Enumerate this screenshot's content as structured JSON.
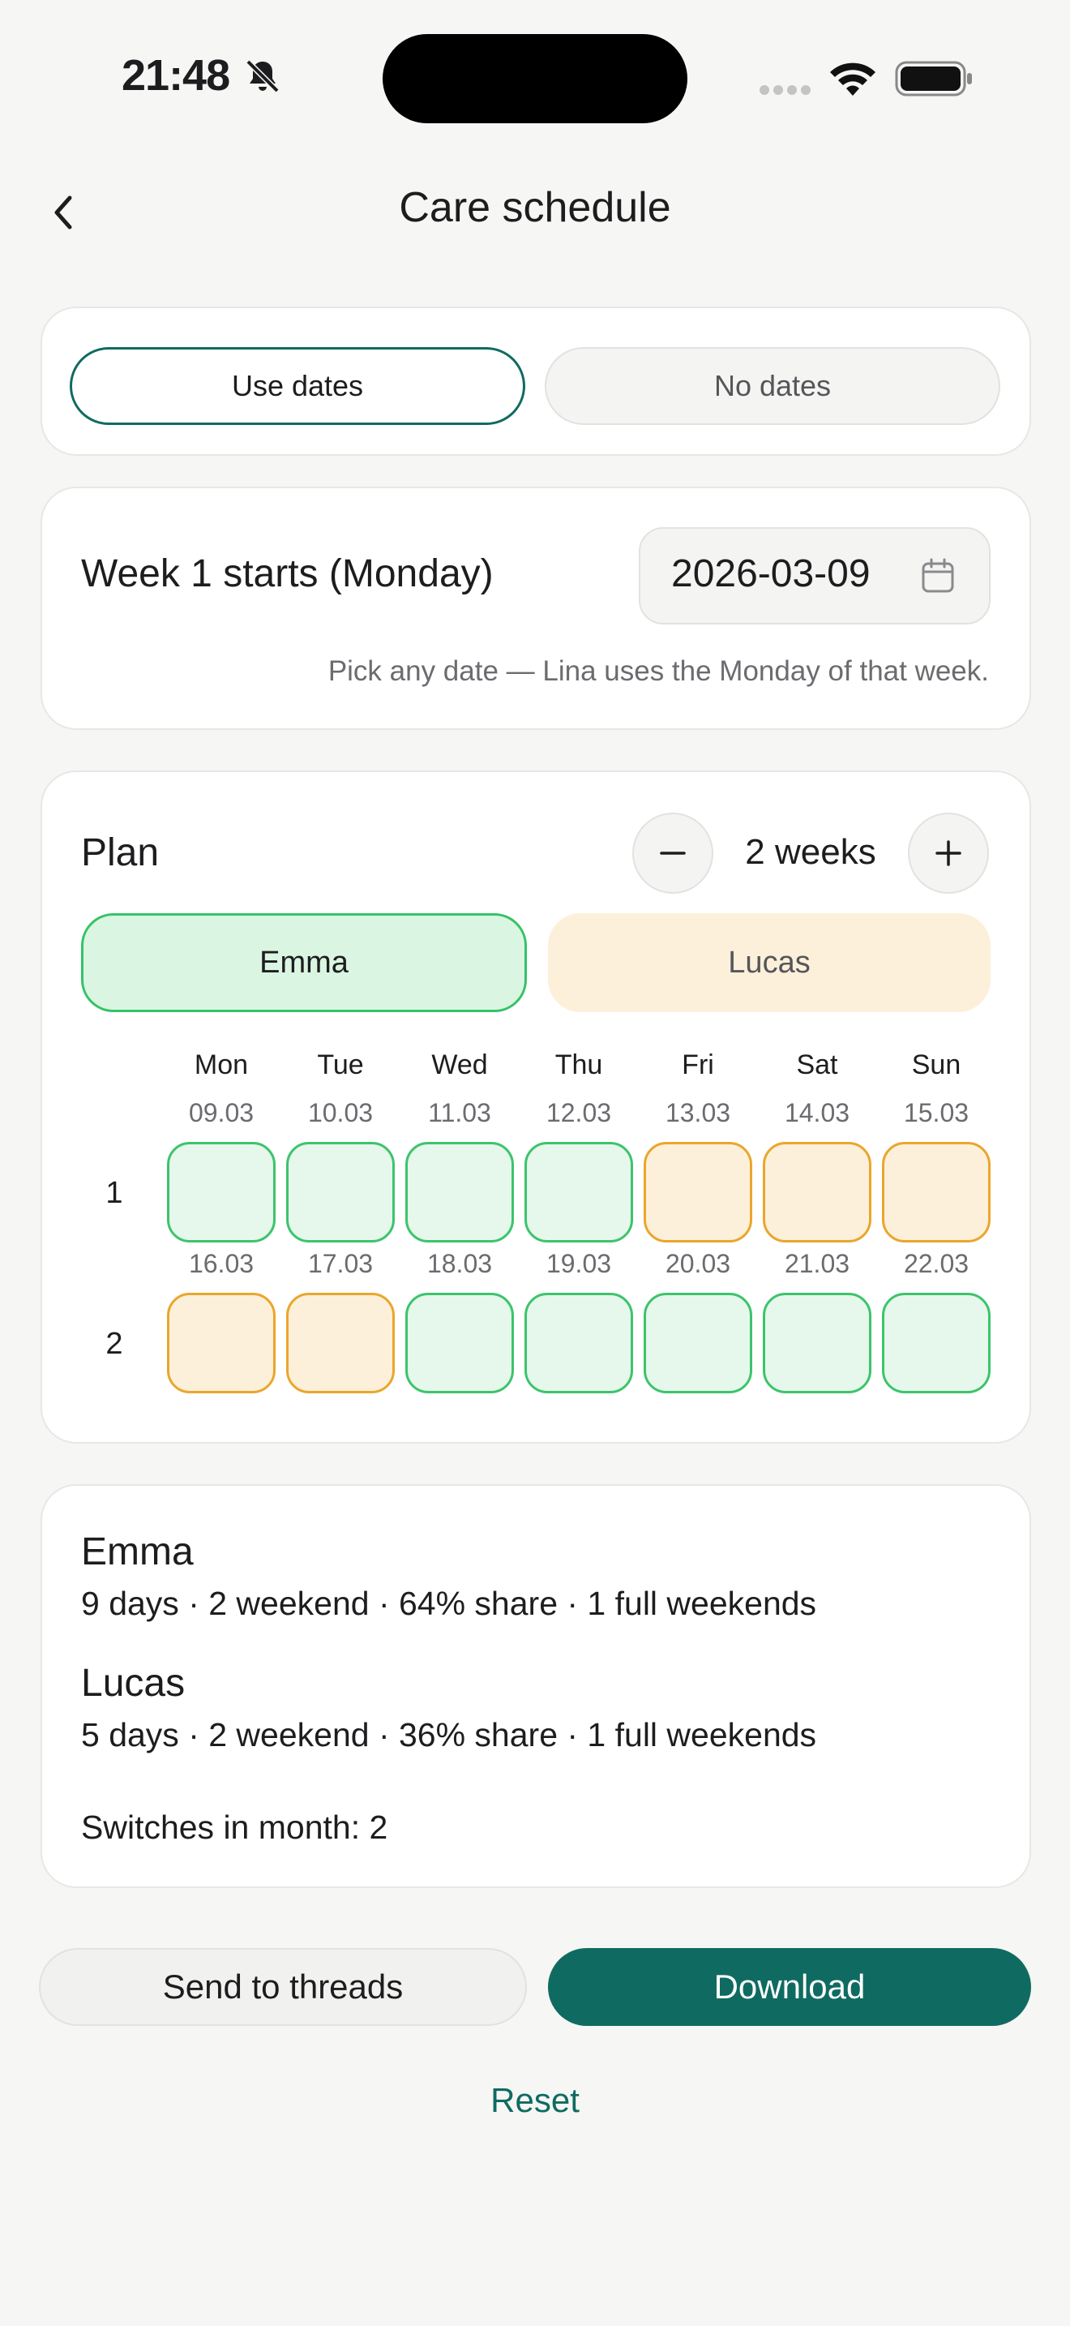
{
  "status_bar": {
    "time": "21:48"
  },
  "header": {
    "title": "Care schedule"
  },
  "mode": {
    "options": [
      "Use dates",
      "No dates"
    ],
    "selected": "Use dates"
  },
  "week_start": {
    "label": "Week 1 starts (Monday)",
    "date": "2026-03-09",
    "hint": "Pick any date — Lina uses the Monday of that week."
  },
  "plan": {
    "label": "Plan",
    "weeks_value": "2 weeks",
    "people": [
      "Emma",
      "Lucas"
    ],
    "selected_person": "Emma",
    "day_names": [
      "Mon",
      "Tue",
      "Wed",
      "Thu",
      "Fri",
      "Sat",
      "Sun"
    ],
    "weeks": [
      {
        "number": "1",
        "dates": [
          "09.03",
          "10.03",
          "11.03",
          "12.03",
          "13.03",
          "14.03",
          "15.03"
        ],
        "assign": [
          "Emma",
          "Emma",
          "Emma",
          "Emma",
          "Lucas",
          "Lucas",
          "Lucas"
        ]
      },
      {
        "number": "2",
        "dates": [
          "16.03",
          "17.03",
          "18.03",
          "19.03",
          "20.03",
          "21.03",
          "22.03"
        ],
        "assign": [
          "Lucas",
          "Lucas",
          "Emma",
          "Emma",
          "Emma",
          "Emma",
          "Emma"
        ]
      }
    ],
    "colors": {
      "Emma": "#3cc46c",
      "Lucas": "#eaa62c"
    }
  },
  "summary": {
    "people": [
      {
        "name": "Emma",
        "detail": "9 days · 2 weekend · 64% share · 1 full weekends"
      },
      {
        "name": "Lucas",
        "detail": "5 days · 2 weekend · 36% share · 1 full weekends"
      }
    ],
    "switches": "Switches in month: 2"
  },
  "actions": {
    "send": "Send to threads",
    "download": "Download",
    "reset": "Reset"
  },
  "accent": "#0f6b61"
}
